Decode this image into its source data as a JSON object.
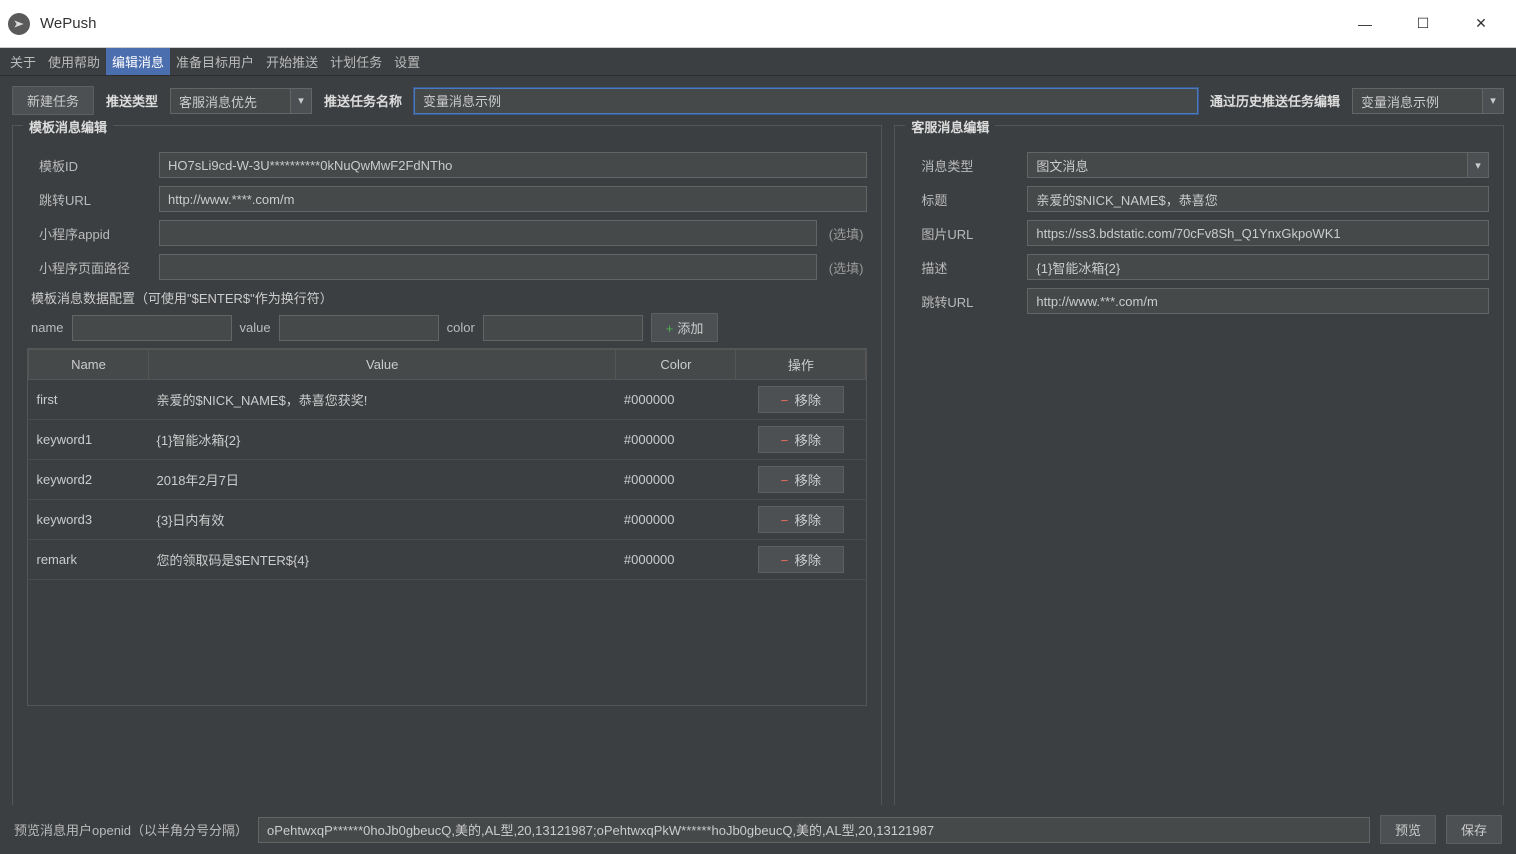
{
  "window": {
    "title": "WePush"
  },
  "menu": {
    "items": [
      "关于",
      "使用帮助",
      "编辑消息",
      "准备目标用户",
      "开始推送",
      "计划任务",
      "设置"
    ],
    "active_index": 2
  },
  "toolbar": {
    "new_task": "新建任务",
    "push_type_label": "推送类型",
    "push_type_value": "客服消息优先",
    "task_name_label": "推送任务名称",
    "task_name_value": "变量消息示例",
    "history_label": "通过历史推送任务编辑",
    "history_value": "变量消息示例"
  },
  "template_panel": {
    "title": "模板消息编辑",
    "template_id_label": "模板ID",
    "template_id_value": "HO7sLi9cd-W-3U**********0kNuQwMwF2FdNTho",
    "jump_url_label": "跳转URL",
    "jump_url_value": "http://www.****.com/m",
    "mini_appid_label": "小程序appid",
    "mini_appid_value": "",
    "mini_path_label": "小程序页面路径",
    "mini_path_value": "",
    "optional_hint": "(选填)",
    "config_hint": "模板消息数据配置（可使用\"$ENTER$\"作为换行符）",
    "name_label": "name",
    "value_label": "value",
    "color_label": "color",
    "add_button": "添加",
    "columns": {
      "name": "Name",
      "value": "Value",
      "color": "Color",
      "action": "操作"
    },
    "remove_label": "移除",
    "rows": [
      {
        "name": "first",
        "value": "亲爱的$NICK_NAME$，恭喜您获奖!",
        "color": "#000000"
      },
      {
        "name": "keyword1",
        "value": "{1}智能冰箱{2}",
        "color": "#000000"
      },
      {
        "name": "keyword2",
        "value": "2018年2月7日",
        "color": "#000000"
      },
      {
        "name": "keyword3",
        "value": "{3}日内有效",
        "color": "#000000"
      },
      {
        "name": "remark",
        "value": "您的领取码是$ENTER${4}",
        "color": "#000000"
      }
    ]
  },
  "kefu_panel": {
    "title": "客服消息编辑",
    "msg_type_label": "消息类型",
    "msg_type_value": "图文消息",
    "title_label": "标题",
    "title_value": "亲爱的$NICK_NAME$，恭喜您",
    "pic_url_label": "图片URL",
    "pic_url_value": "https://ss3.bdstatic.com/70cFv8Sh_Q1YnxGkpoWK1",
    "desc_label": "描述",
    "desc_value": "{1}智能冰箱{2}",
    "jump_url_label": "跳转URL",
    "jump_url_value": "http://www.***.com/m"
  },
  "footer": {
    "label": "预览消息用户openid（以半角分号分隔）",
    "value": "oPehtwxqP******0hoJb0gbeucQ,美的,AL型,20,13121987;oPehtwxqPkW******hoJb0gbeucQ,美的,AL型,20,13121987",
    "preview": "预览",
    "save": "保存"
  }
}
